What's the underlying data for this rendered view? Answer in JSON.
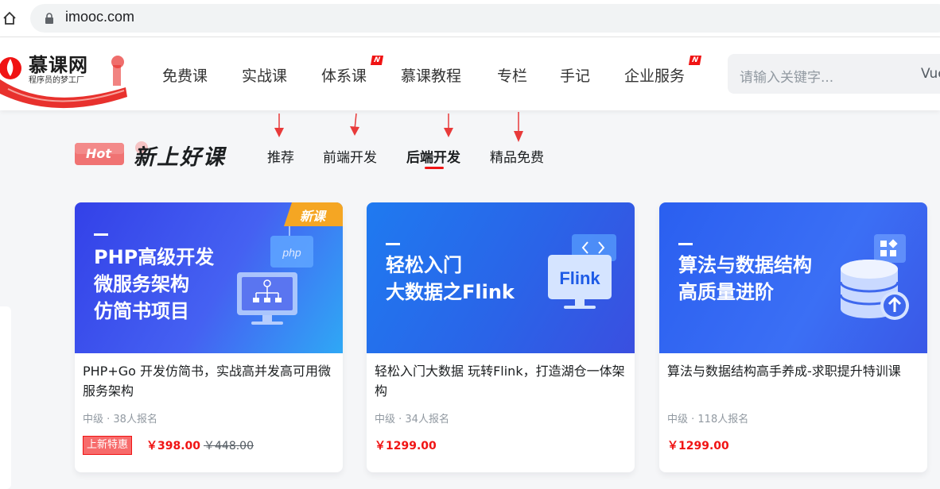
{
  "browser": {
    "url": "imooc.com"
  },
  "header": {
    "logo_title": "慕课网",
    "logo_subtitle": "程序员的梦工厂",
    "nav": [
      {
        "label": "免费课",
        "badge": ""
      },
      {
        "label": "实战课",
        "badge": ""
      },
      {
        "label": "体系课",
        "badge": "N"
      },
      {
        "label": "慕课教程",
        "badge": ""
      },
      {
        "label": "专栏",
        "badge": ""
      },
      {
        "label": "手记",
        "badge": ""
      },
      {
        "label": "企业服务",
        "badge": "N"
      }
    ],
    "search_placeholder": "请输入关键字...",
    "search_hot": "Vue"
  },
  "section": {
    "hot_label": "Hot",
    "title": "新上好课",
    "tabs": [
      {
        "label": "推荐",
        "active": false
      },
      {
        "label": "前端开发",
        "active": false
      },
      {
        "label": "后端开发",
        "active": true
      },
      {
        "label": "精品免费",
        "active": false
      }
    ]
  },
  "cards": [
    {
      "banner_lines": [
        "PHP高级开发",
        "微服务架构",
        "仿简书项目"
      ],
      "badge": "新课",
      "title": "PHP+Go 开发仿简书，实战高并发高可用微服务架构",
      "meta": "中级 · 38人报名",
      "promo": "上新特惠",
      "price": "￥398.00",
      "old_price": "￥448.00",
      "icon": "php-monitor-icon"
    },
    {
      "banner_lines": [
        "轻松入门",
        "大数据之Flink"
      ],
      "badge": "",
      "title": "轻松入门大数据 玩转Flink，打造湖仓一体架构",
      "meta": "中级 · 34人报名",
      "promo": "",
      "price": "￥1299.00",
      "old_price": "",
      "icon": "flink-monitor-icon",
      "icon_text": "Flink"
    },
    {
      "banner_lines": [
        "算法与数据结构",
        "高质量进阶"
      ],
      "badge": "",
      "title": "算法与数据结构高手养成-求职提升特训课",
      "meta": "中级 · 118人报名",
      "promo": "",
      "price": "￥1299.00",
      "old_price": "",
      "icon": "database-upload-icon"
    }
  ],
  "colors": {
    "brand_red": "#f01414",
    "card1_banner": "#3a4ff0",
    "card2_banner": "#1b6ef0",
    "card3_banner": "#2f6cf2"
  }
}
